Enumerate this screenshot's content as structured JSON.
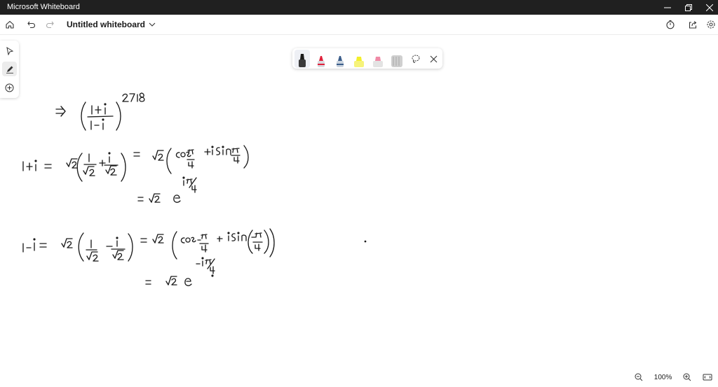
{
  "window": {
    "title": "Microsoft Whiteboard"
  },
  "toolbar": {
    "board_title": "Untitled whiteboard"
  },
  "icons": {
    "home": "home-icon",
    "undo": "undo-icon",
    "redo": "redo-icon",
    "chevron": "chevron-down-icon",
    "timer": "timer-icon",
    "share": "share-icon",
    "settings": "gear-icon",
    "select": "pointer-icon",
    "pen": "pen-icon",
    "add": "plus-circle-icon",
    "lasso": "lasso-icon",
    "close": "close-icon",
    "zoom_out": "zoom-out-icon",
    "zoom_in": "zoom-in-icon",
    "fit": "fit-screen-icon"
  },
  "pens": [
    {
      "name": "black-pen",
      "color": "#1b1b1b",
      "selected": true
    },
    {
      "name": "red-pen",
      "color": "#e0213b"
    },
    {
      "name": "blue-pen",
      "color": "#3b5d8a"
    },
    {
      "name": "yellow-highlighter",
      "color": "#f3ef2a"
    },
    {
      "name": "pink-highlighter",
      "color": "#f08aa6"
    },
    {
      "name": "ruler",
      "color": "#b9b9b9"
    }
  ],
  "zoom": {
    "level": "100%"
  },
  "colors": {
    "titlebar": "#202020",
    "ink": "#1b1b1b"
  }
}
